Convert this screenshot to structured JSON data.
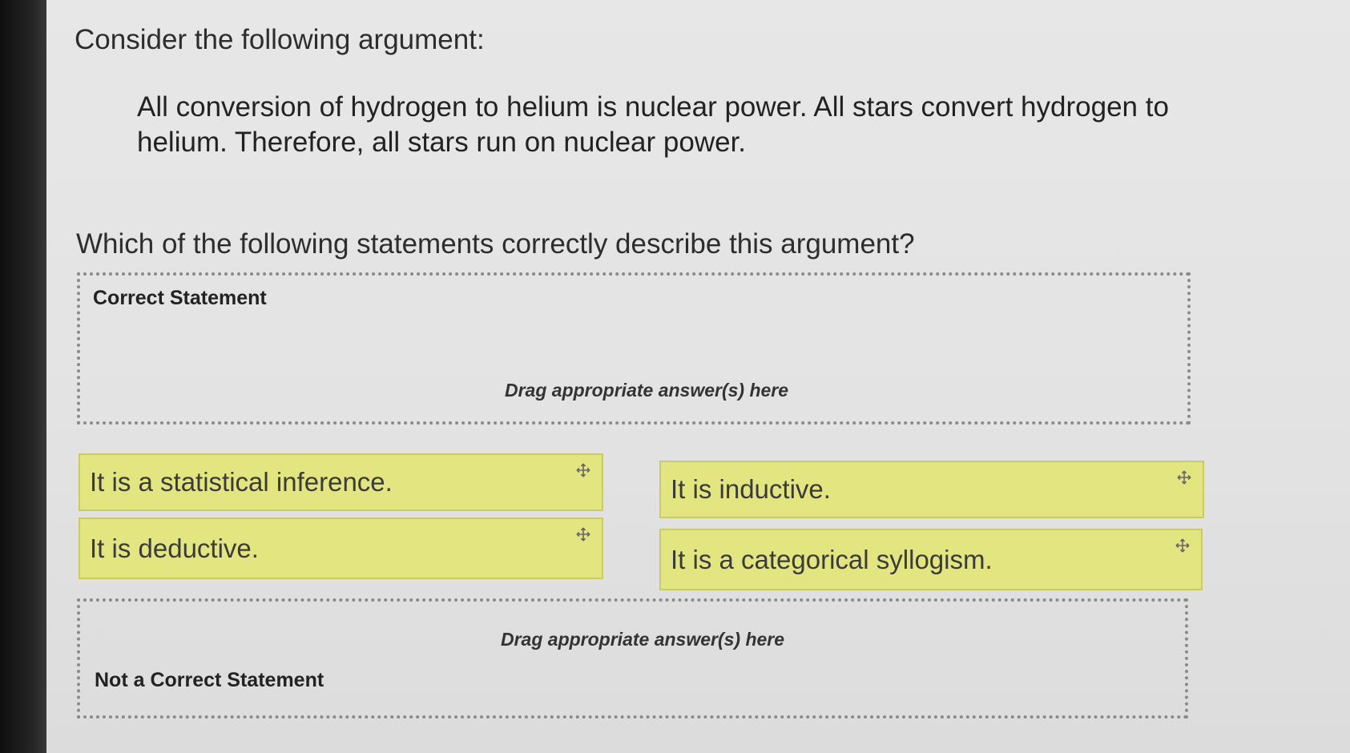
{
  "question": {
    "title": "Consider the following argument:",
    "argument": "All conversion of hydrogen to helium is nuclear power. All stars convert hydrogen to helium. Therefore, all stars run on nuclear power.",
    "prompt": "Which of the following statements correctly describe this argument?"
  },
  "zones": {
    "correct": {
      "label": "Correct Statement",
      "hint": "Drag appropriate answer(s) here"
    },
    "incorrect": {
      "label": "Not a Correct Statement",
      "hint": "Drag appropriate answer(s) here"
    }
  },
  "answers": [
    {
      "text": "It is a statistical inference.",
      "icon": "move-icon"
    },
    {
      "text": "It is inductive.",
      "icon": "move-icon"
    },
    {
      "text": "It is deductive.",
      "icon": "move-icon"
    },
    {
      "text": "It is a categorical syllogism.",
      "icon": "move-icon"
    }
  ],
  "colors": {
    "tile_background": "#e3e680",
    "tile_border": "#c8cb6a",
    "page_background": "#e5e5e5"
  }
}
